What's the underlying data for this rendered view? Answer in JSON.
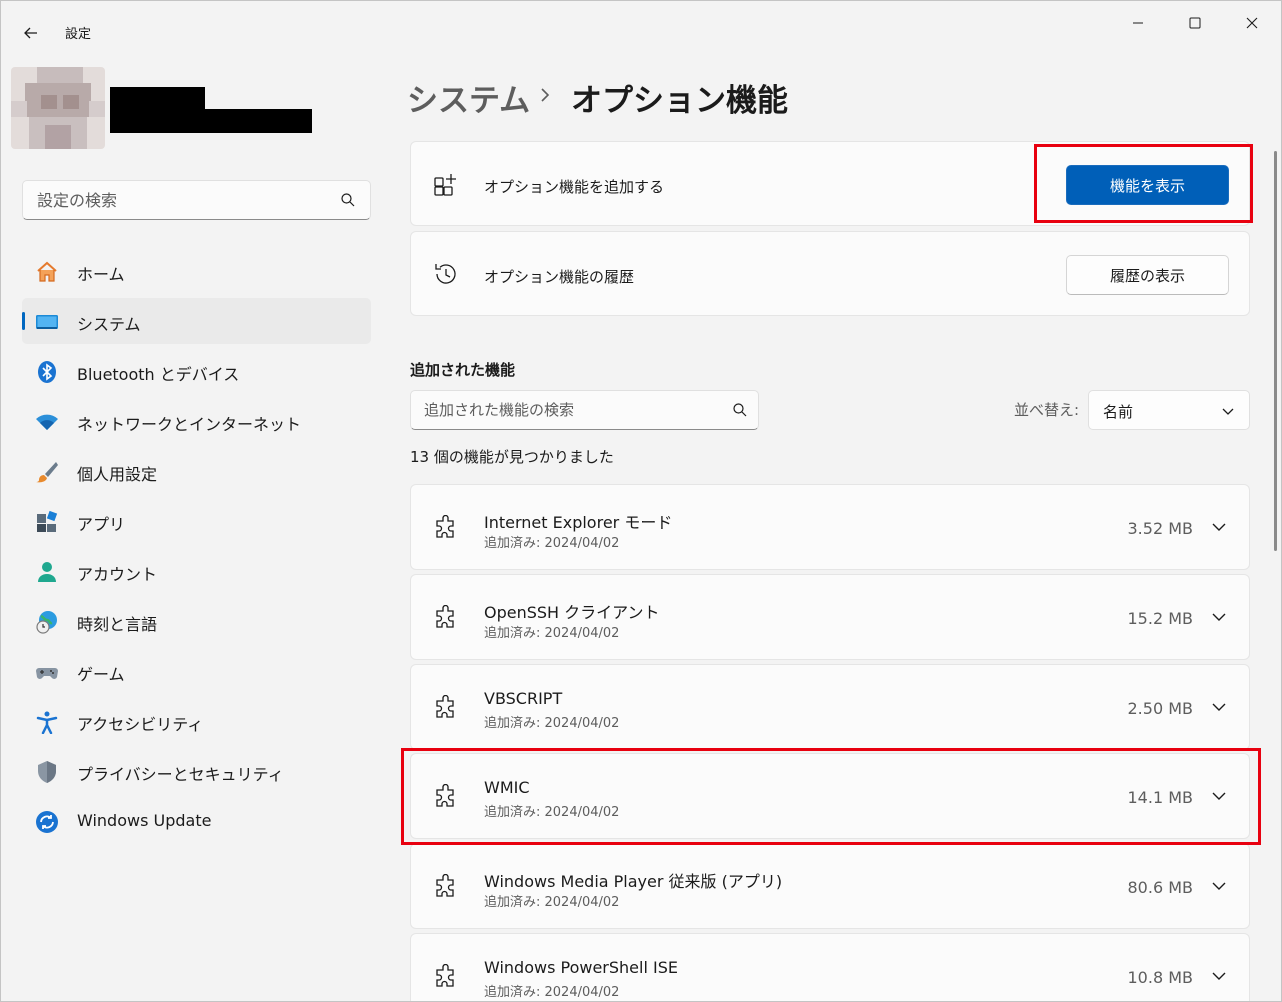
{
  "window": {
    "app_title": "設定",
    "controls": {
      "minimize": "minimize-icon",
      "maximize": "maximize-icon",
      "close": "close-icon"
    }
  },
  "sidebar": {
    "search_placeholder": "設定の検索",
    "items": [
      {
        "label": "ホーム",
        "icon": "home-icon",
        "active": false
      },
      {
        "label": "システム",
        "icon": "system-icon",
        "active": true
      },
      {
        "label": "Bluetooth とデバイス",
        "icon": "bluetooth-icon",
        "active": false
      },
      {
        "label": "ネットワークとインターネット",
        "icon": "wifi-icon",
        "active": false
      },
      {
        "label": "個人用設定",
        "icon": "brush-icon",
        "active": false
      },
      {
        "label": "アプリ",
        "icon": "apps-icon",
        "active": false
      },
      {
        "label": "アカウント",
        "icon": "account-icon",
        "active": false
      },
      {
        "label": "時刻と言語",
        "icon": "globe-clock-icon",
        "active": false
      },
      {
        "label": "ゲーム",
        "icon": "gamepad-icon",
        "active": false
      },
      {
        "label": "アクセシビリティ",
        "icon": "accessibility-icon",
        "active": false
      },
      {
        "label": "プライバシーとセキュリティ",
        "icon": "shield-icon",
        "active": false
      },
      {
        "label": "Windows Update",
        "icon": "update-icon",
        "active": false
      }
    ]
  },
  "main": {
    "breadcrumb": {
      "parent": "システム",
      "current": "オプション機能"
    },
    "add_card": {
      "label": "オプション機能を追加する",
      "button": "機能を表示"
    },
    "history_card": {
      "label": "オプション機能の履歴",
      "button": "履歴の表示"
    },
    "installed": {
      "title": "追加された機能",
      "search_placeholder": "追加された機能の検索",
      "sort_label": "並べ替え:",
      "sort_value": "名前",
      "count_text": "13 個の機能が見つかりました",
      "features": [
        {
          "name": "Internet Explorer モード",
          "date": "追加済み: 2024/04/02",
          "size": "3.52 MB"
        },
        {
          "name": "OpenSSH クライアント",
          "date": "追加済み: 2024/04/02",
          "size": "15.2 MB"
        },
        {
          "name": "VBSCRIPT",
          "date": "追加済み: 2024/04/02",
          "size": "2.50 MB"
        },
        {
          "name": "WMIC",
          "date": "追加済み: 2024/04/02",
          "size": "14.1 MB"
        },
        {
          "name": "Windows Media Player 従来版 (アプリ)",
          "date": "追加済み: 2024/04/02",
          "size": "80.6 MB"
        },
        {
          "name": "Windows PowerShell ISE",
          "date": "追加済み: 2024/04/02",
          "size": "10.8 MB"
        }
      ]
    }
  },
  "colors": {
    "accent": "#005fb8",
    "highlight": "#e8000f",
    "background": "#f3f3f3",
    "card": "#fbfbfb"
  }
}
